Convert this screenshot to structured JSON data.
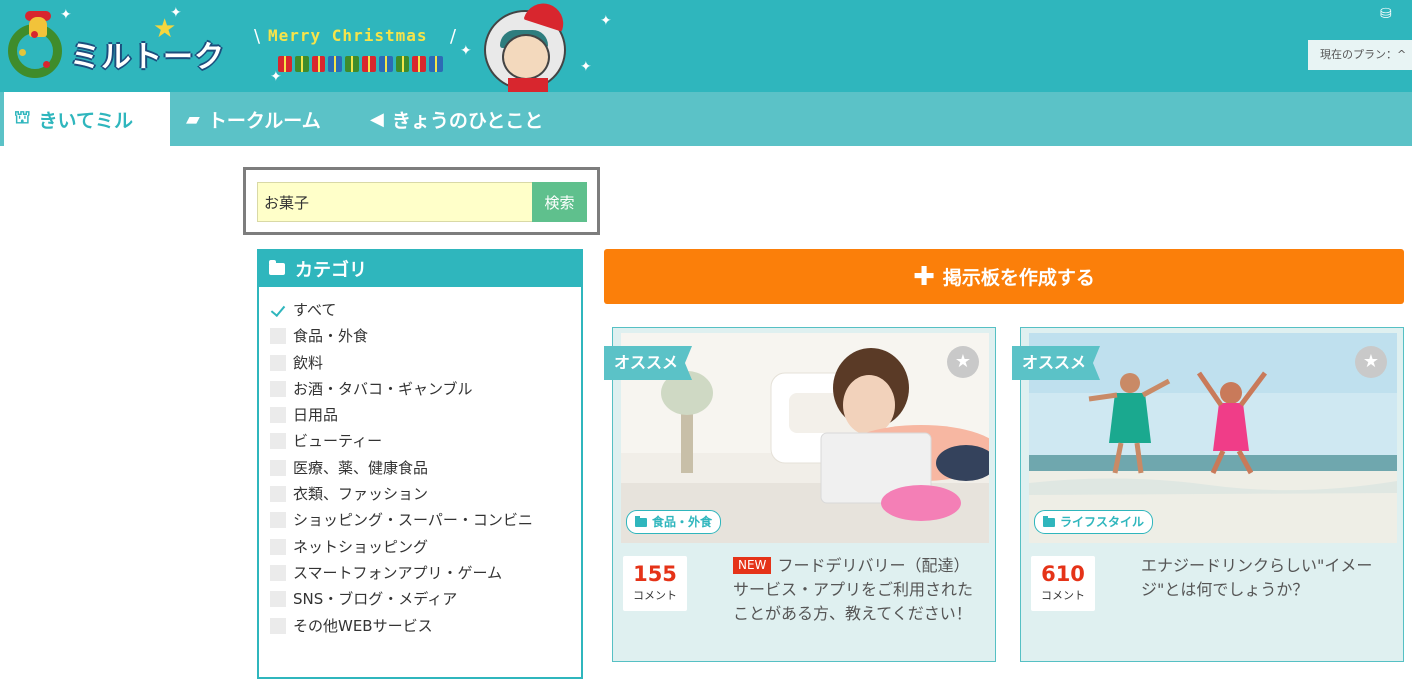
{
  "header": {
    "logo_text": "ミルトーク",
    "banner_text": "Merry Christmas",
    "plan_label": "現在のプラン：^",
    "plan_icon": "coins-icon"
  },
  "nav": {
    "items": [
      {
        "label": "きいてミル",
        "icon": "ask-icon",
        "active": true
      },
      {
        "label": "トークルーム",
        "icon": "chat-bubbles-icon",
        "active": false
      },
      {
        "label": "きょうのひとこと",
        "icon": "megaphone-icon",
        "active": false
      }
    ]
  },
  "search": {
    "value": "お菓子",
    "button_label": "検索"
  },
  "categories": {
    "title": "カテゴリ",
    "items": [
      {
        "label": "すべて",
        "checked": true
      },
      {
        "label": "食品・外食",
        "checked": false
      },
      {
        "label": "飲料",
        "checked": false
      },
      {
        "label": "お酒・タバコ・ギャンブル",
        "checked": false
      },
      {
        "label": "日用品",
        "checked": false
      },
      {
        "label": "ビューティー",
        "checked": false
      },
      {
        "label": "医療、薬、健康食品",
        "checked": false
      },
      {
        "label": "衣類、ファッション",
        "checked": false
      },
      {
        "label": "ショッピング・スーパー・コンビニ",
        "checked": false
      },
      {
        "label": "ネットショッピング",
        "checked": false
      },
      {
        "label": "スマートフォンアプリ・ゲーム",
        "checked": false
      },
      {
        "label": "SNS・ブログ・メディア",
        "checked": false
      },
      {
        "label": "その他WEBサービス",
        "checked": false
      }
    ]
  },
  "create_button": {
    "label": "掲示板を作成する"
  },
  "cards": [
    {
      "recommend": "オススメ",
      "category": "食品・外食",
      "count": "155",
      "count_label": "コメント",
      "new_label": "NEW",
      "title": "フードデリバリー（配達）サービス・アプリをご利用されたことがある方、教えてください！"
    },
    {
      "recommend": "オススメ",
      "category": "ライフスタイル",
      "count": "610",
      "count_label": "コメント",
      "new_label": "",
      "title": "エナジードリンクらしい\"イメージ\"とは何でしょうか？"
    }
  ],
  "colors": {
    "header_bg": "#2fb6bd",
    "nav_bg": "#5bc2c7",
    "create_btn": "#fb7f0a",
    "search_btn": "#5fc08d",
    "count": "#e53318"
  }
}
